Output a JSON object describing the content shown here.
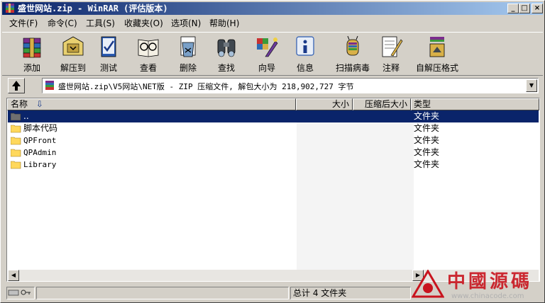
{
  "window": {
    "title": "盛世网站.zip - WinRAR (评估版本)",
    "buttons": {
      "minimize": "_",
      "maximize": "□",
      "close": "×"
    }
  },
  "menu": [
    "文件(F)",
    "命令(C)",
    "工具(S)",
    "收藏夹(O)",
    "选项(N)",
    "帮助(H)"
  ],
  "toolbar": [
    {
      "label": "添加",
      "icon": "add-archive-icon"
    },
    {
      "label": "解压到",
      "icon": "extract-to-icon"
    },
    {
      "label": "测试",
      "icon": "test-icon"
    },
    {
      "label": "查看",
      "icon": "view-icon"
    },
    {
      "label": "删除",
      "icon": "delete-icon"
    },
    {
      "label": "查找",
      "icon": "find-icon"
    },
    {
      "label": "向导",
      "icon": "wizard-icon"
    },
    {
      "label": "信息",
      "icon": "info-icon"
    },
    {
      "label": "扫描病毒",
      "icon": "virus-scan-icon"
    },
    {
      "label": "注释",
      "icon": "comment-icon"
    },
    {
      "label": "自解压格式",
      "icon": "sfx-icon"
    }
  ],
  "address": {
    "path": "盛世网站.zip\\V5网站\\NET版 - ZIP 压缩文件, 解包大小为 218,902,727 字节"
  },
  "columns": {
    "name": "名称",
    "size": "大小",
    "packed": "压缩后大小",
    "type": "类型"
  },
  "rows": [
    {
      "name": "..",
      "type": "文件夹"
    },
    {
      "name": "脚本代码",
      "type": "文件夹"
    },
    {
      "name": "QPFront",
      "type": "文件夹"
    },
    {
      "name": "QPAdmin",
      "type": "文件夹"
    },
    {
      "name": "Library",
      "type": "文件夹"
    }
  ],
  "status": {
    "summary": "总计 4 文件夹"
  },
  "watermark": {
    "text": "中國源碼",
    "url": "www.chinacode.com"
  },
  "colors": {
    "title_active": "#0a246a",
    "selection": "#0a246a",
    "watermark": "#c8141e"
  }
}
